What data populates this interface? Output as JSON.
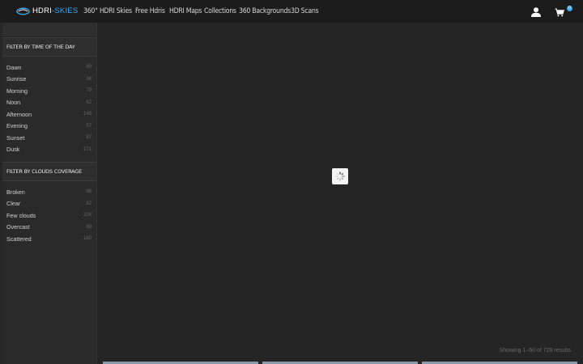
{
  "header": {
    "logo_text_a": "HDRI",
    "logo_text_b": "-SKIES",
    "nav": [
      "360° HDRI Skies",
      "Free Hdris",
      "HDRI Maps",
      "Collections",
      "360 Backgrounds",
      "3D Scans"
    ],
    "cart_count": "0"
  },
  "sidebar": {
    "sections": [
      {
        "title": "FILTER BY TIME OF THE DAY",
        "items": [
          {
            "label": "Dawn",
            "count": "60"
          },
          {
            "label": "Sunrise",
            "count": "34"
          },
          {
            "label": "Morning",
            "count": "79"
          },
          {
            "label": "Noon",
            "count": "62"
          },
          {
            "label": "Afternoon",
            "count": "148"
          },
          {
            "label": "Evening",
            "count": "57"
          },
          {
            "label": "Sunset",
            "count": "87"
          },
          {
            "label": "Dusk",
            "count": "171"
          }
        ]
      },
      {
        "title": "FILTER BY CLOUDS COVERAGE",
        "items": [
          {
            "label": "Broken",
            "count": "98"
          },
          {
            "label": "Clear",
            "count": "82"
          },
          {
            "label": "Few clouds",
            "count": "224"
          },
          {
            "label": "Overcast",
            "count": "89"
          },
          {
            "label": "Scattered",
            "count": "160"
          }
        ]
      }
    ]
  },
  "main": {
    "results_text": "Showing 1–60 of 728 results"
  },
  "colors": {
    "accent": "#3fa9f5",
    "header_bg": "#1c1c1c",
    "content_bg": "#252525"
  },
  "icons": [
    "hdri-skies-logo-icon",
    "user-icon",
    "cart-icon",
    "loading-spinner-icon"
  ]
}
